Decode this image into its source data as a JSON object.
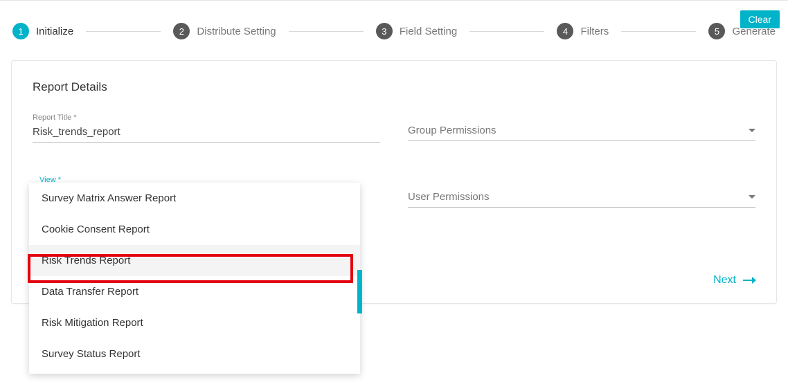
{
  "clear_button": "Clear",
  "stepper": {
    "steps": [
      {
        "num": "1",
        "label": "Initialize",
        "active": true
      },
      {
        "num": "2",
        "label": "Distribute Setting",
        "active": false
      },
      {
        "num": "3",
        "label": "Field Setting",
        "active": false
      },
      {
        "num": "4",
        "label": "Filters",
        "active": false
      },
      {
        "num": "5",
        "label": "Generate",
        "active": false
      }
    ]
  },
  "card": {
    "title": "Report Details",
    "report_title_label": "Report Title *",
    "report_title_value": "Risk_trends_report",
    "view_label": "View *",
    "group_perm_label": "Group Permissions",
    "user_perm_label": "User Permissions",
    "next_label": "Next"
  },
  "view_options": [
    "Survey Matrix Answer Report",
    "Cookie Consent Report",
    "Risk Trends Report",
    "Data Transfer Report",
    "Risk Mitigation Report",
    "Survey Status Report"
  ],
  "view_highlight_index": 2
}
